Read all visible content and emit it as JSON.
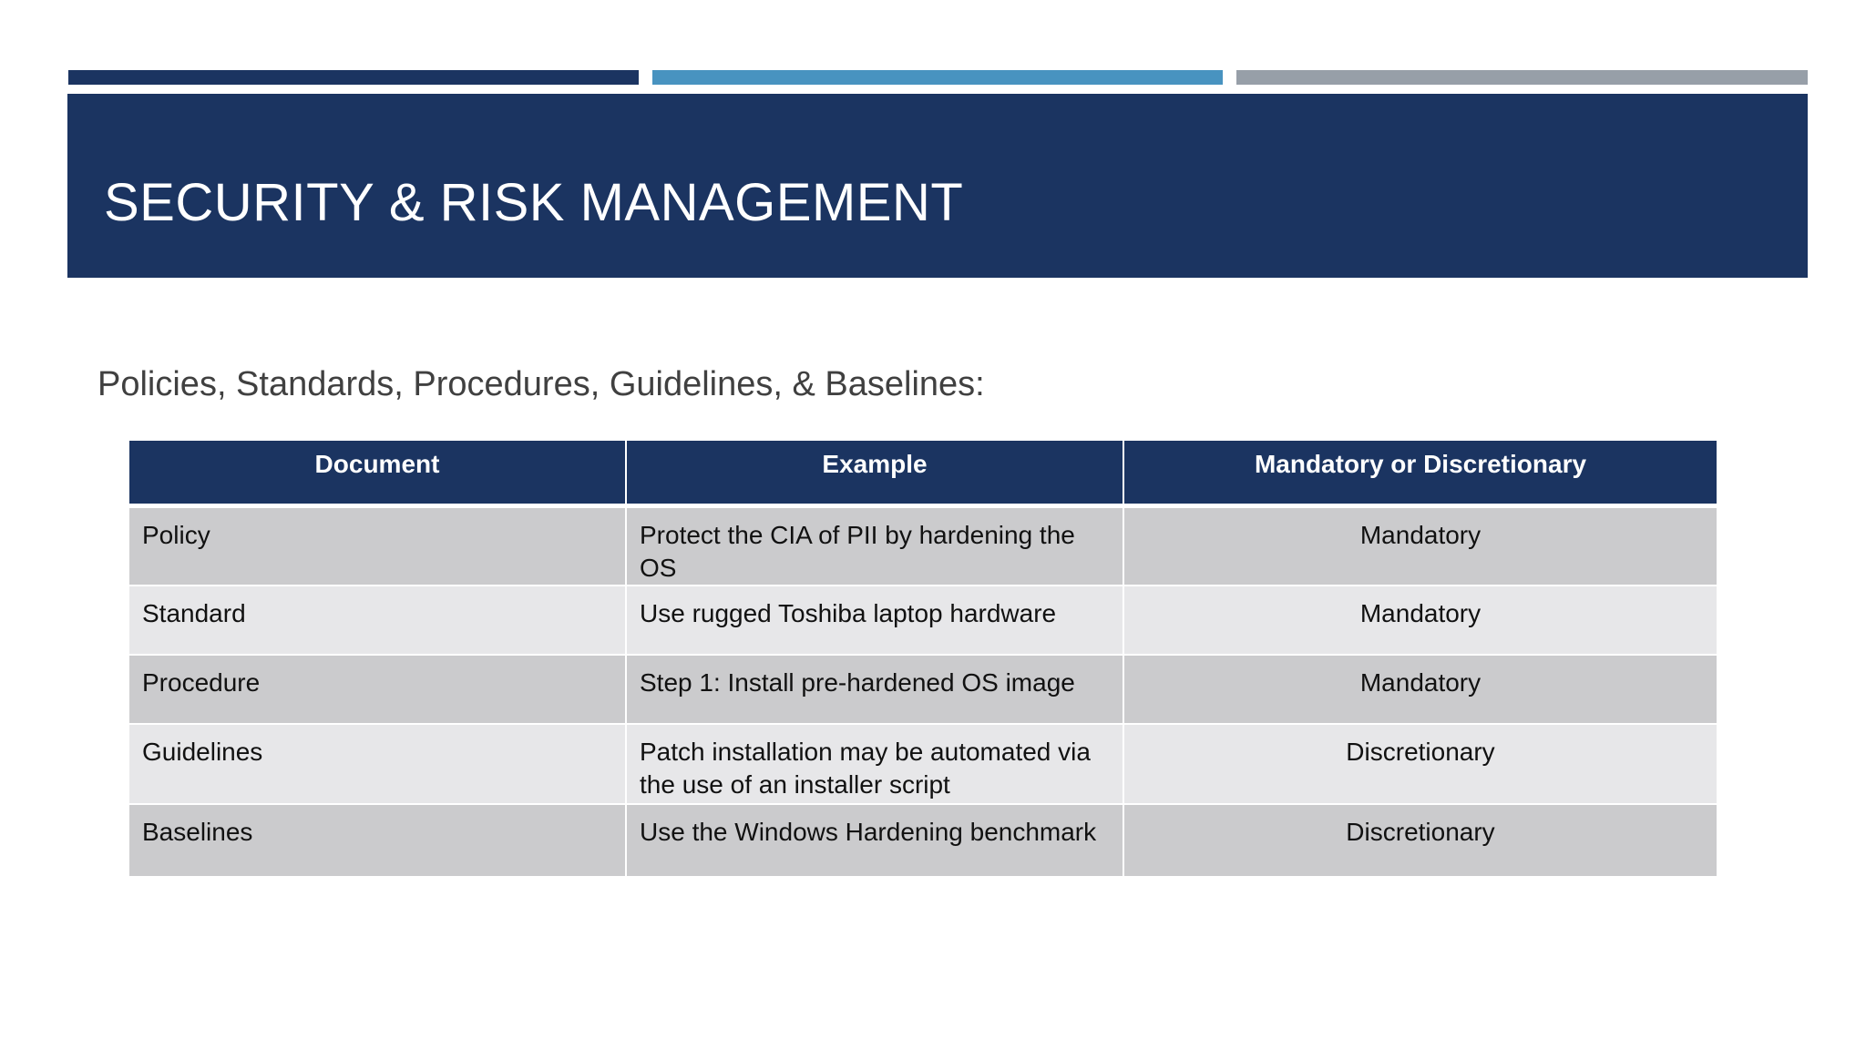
{
  "colors": {
    "navy": "#1b3461",
    "accent_dark": "#1b3461",
    "accent_blue": "#4893c0",
    "accent_gray": "#979fa8",
    "row_dark": "#cbcbcd",
    "row_light": "#e7e7e9",
    "text_dark": "#111111",
    "subtitle_text": "#404040"
  },
  "slide": {
    "title": "SECURITY & RISK MANAGEMENT",
    "subtitle": "Policies, Standards, Procedures, Guidelines, & Baselines:"
  },
  "table": {
    "headers": [
      "Document",
      "Example",
      "Mandatory or Discretionary"
    ],
    "rows": [
      {
        "document": "Policy",
        "example": "Protect the CIA of PII by hardening the OS",
        "mandatory": "Mandatory"
      },
      {
        "document": "Standard",
        "example": "Use rugged Toshiba laptop hardware",
        "mandatory": "Mandatory"
      },
      {
        "document": "Procedure",
        "example": "Step 1: Install pre-hardened OS image",
        "mandatory": "Mandatory"
      },
      {
        "document": "Guidelines",
        "example": "Patch installation may be automated via the use of an installer script",
        "mandatory": "Discretionary"
      },
      {
        "document": "Baselines",
        "example": "Use the Windows Hardening benchmark",
        "mandatory": "Discretionary"
      }
    ]
  }
}
